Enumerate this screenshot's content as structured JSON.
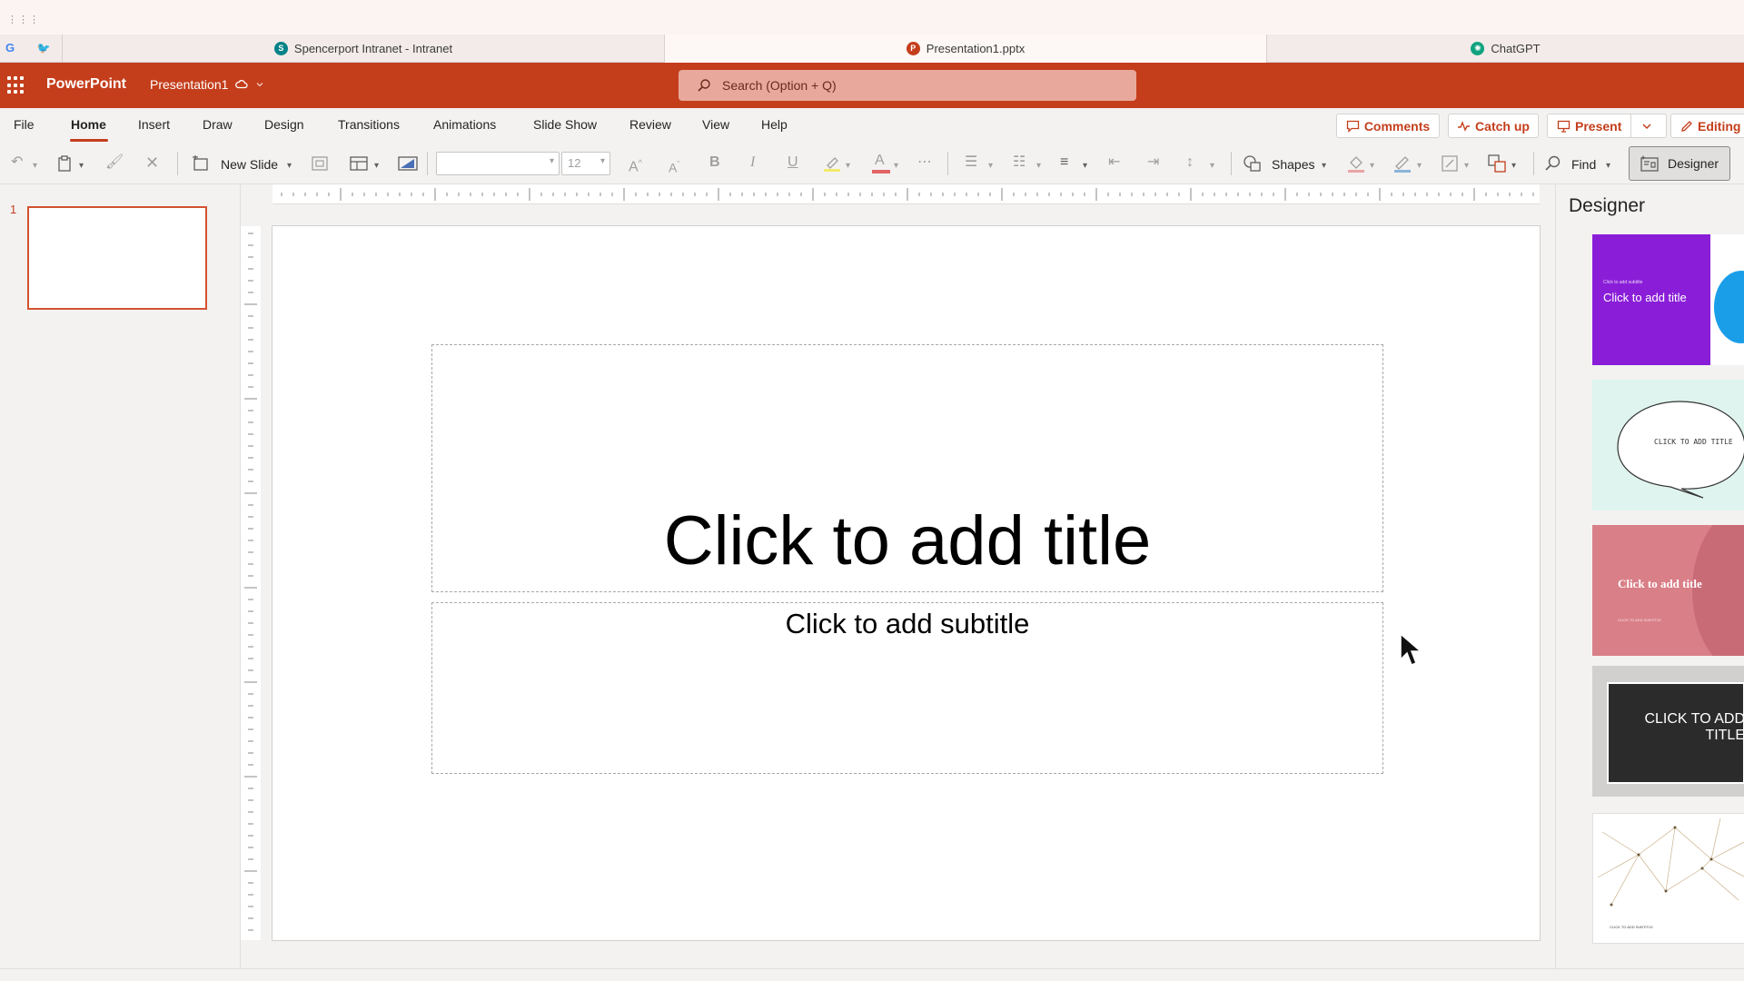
{
  "browser": {
    "pinned": [
      {
        "name": "google",
        "glyph": "G"
      },
      {
        "name": "twitter",
        "glyph": "🐦"
      }
    ],
    "tabs": [
      {
        "label": "Spencerport Intranet - Intranet",
        "icon": "sharepoint-icon",
        "icon_color": "#038387"
      },
      {
        "label": "Presentation1.pptx",
        "icon": "powerpoint-icon",
        "icon_color": "#c43e1c"
      },
      {
        "label": "ChatGPT",
        "icon": "chatgpt-icon",
        "icon_color": "#10a37f"
      }
    ]
  },
  "app": {
    "name": "PowerPoint",
    "document": "Presentation1",
    "search_placeholder": "Search (Option + Q)",
    "brand_color": "#c43e1c"
  },
  "ribbon": {
    "tabs": [
      "File",
      "Home",
      "Insert",
      "Draw",
      "Design",
      "Transitions",
      "Animations",
      "Slide Show",
      "Review",
      "View",
      "Help"
    ],
    "active_tab": "Home",
    "actions": {
      "comments": "Comments",
      "catch_up": "Catch up",
      "present": "Present",
      "editing": "Editing"
    },
    "tools": {
      "new_slide": "New Slide",
      "font_size": "12",
      "shapes": "Shapes",
      "find": "Find",
      "designer": "Designer"
    }
  },
  "slides": {
    "thumbnails": [
      {
        "number": "1"
      }
    ]
  },
  "slide": {
    "title_placeholder": "Click to add title",
    "subtitle_placeholder": "Click to add subtitle"
  },
  "designer": {
    "title": "Designer",
    "cards": [
      {
        "subtitle": "Click to add subtitle",
        "title": "Click to add title",
        "bg": "#8a1ed8"
      },
      {
        "title": "CLICK TO ADD TITLE",
        "bg": "#dff4ee"
      },
      {
        "title": "Click to add title",
        "subtitle": "CLICK TO ADD SUBTITLE",
        "bg": "#d97f88"
      },
      {
        "title": "CLICK TO ADD TITLE",
        "bg": "#2b2b2b"
      },
      {
        "subtitle": "CLICK TO ADD SUBTITLE",
        "bg": "#ffffff"
      }
    ]
  }
}
